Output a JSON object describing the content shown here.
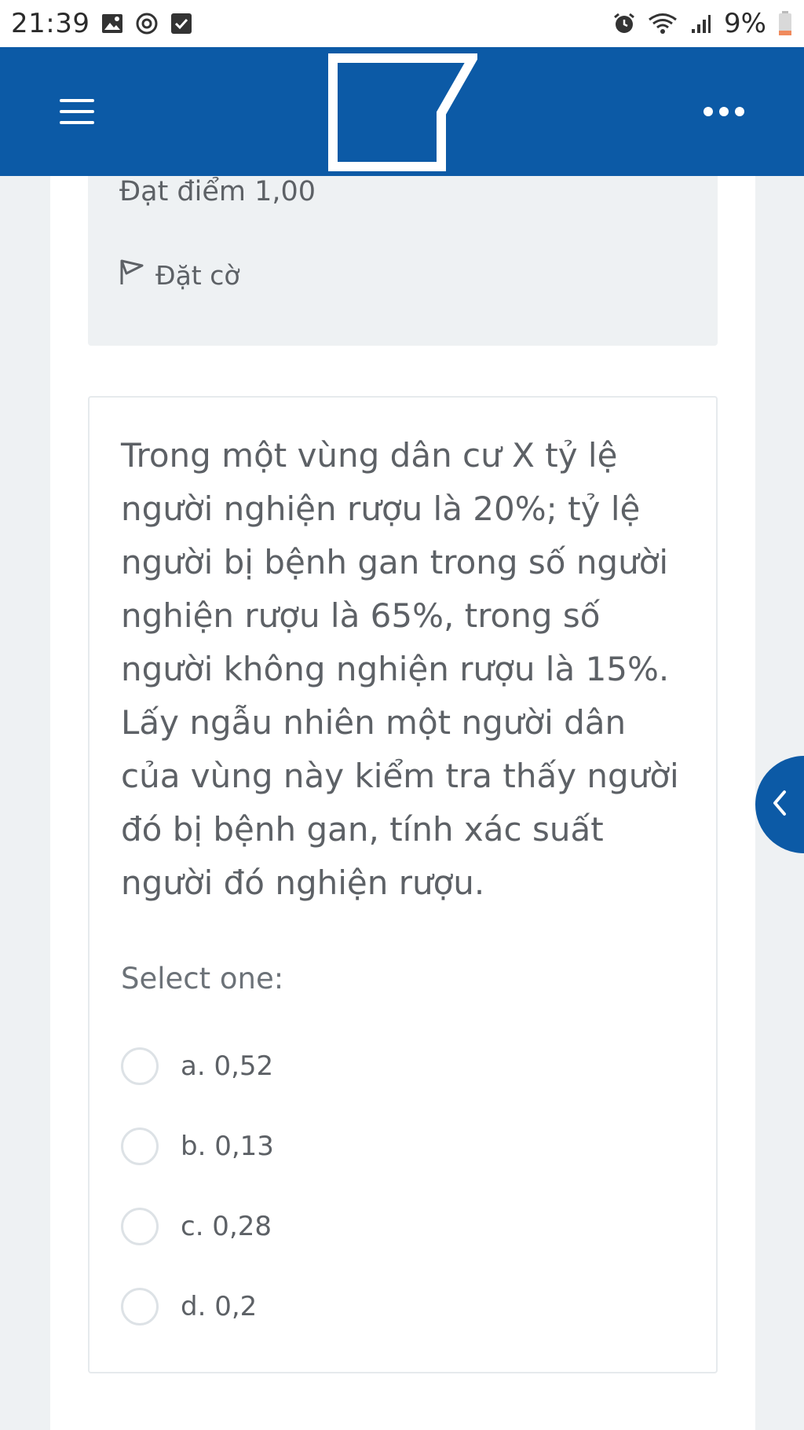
{
  "status_bar": {
    "time": "21:39",
    "battery": "9%",
    "icons": [
      "gallery-icon",
      "sync-icon",
      "checkbox-icon",
      "alarm-icon",
      "wifi-icon",
      "signal-icon",
      "battery-icon"
    ]
  },
  "header": {
    "menu_icon": "hamburger-icon",
    "more_icon": "more-dots-icon",
    "brand_color": "#0c5aa6"
  },
  "question_info": {
    "grade": "Đạt điểm 1,00",
    "flag_label": "Đặt cờ"
  },
  "question": {
    "text": "Trong một vùng dân cư X tỷ lệ người nghiện rượu là 20%; tỷ lệ người bị bệnh gan trong số người nghiện rượu là 65%, trong số người không nghiện rượu là 15%. Lấy ngẫu nhiên một người dân của vùng này kiểm tra thấy người đó bị bệnh gan, tính xác suất người đó nghiện rượu.",
    "prompt": "Select one:",
    "options": [
      {
        "label": "a. 0,52",
        "selected": false
      },
      {
        "label": "b. 0,13",
        "selected": false
      },
      {
        "label": "c. 0,28",
        "selected": false
      },
      {
        "label": "d. 0,2",
        "selected": false
      }
    ]
  },
  "drawer": {
    "toggle_icon": "chevron-left-icon"
  }
}
